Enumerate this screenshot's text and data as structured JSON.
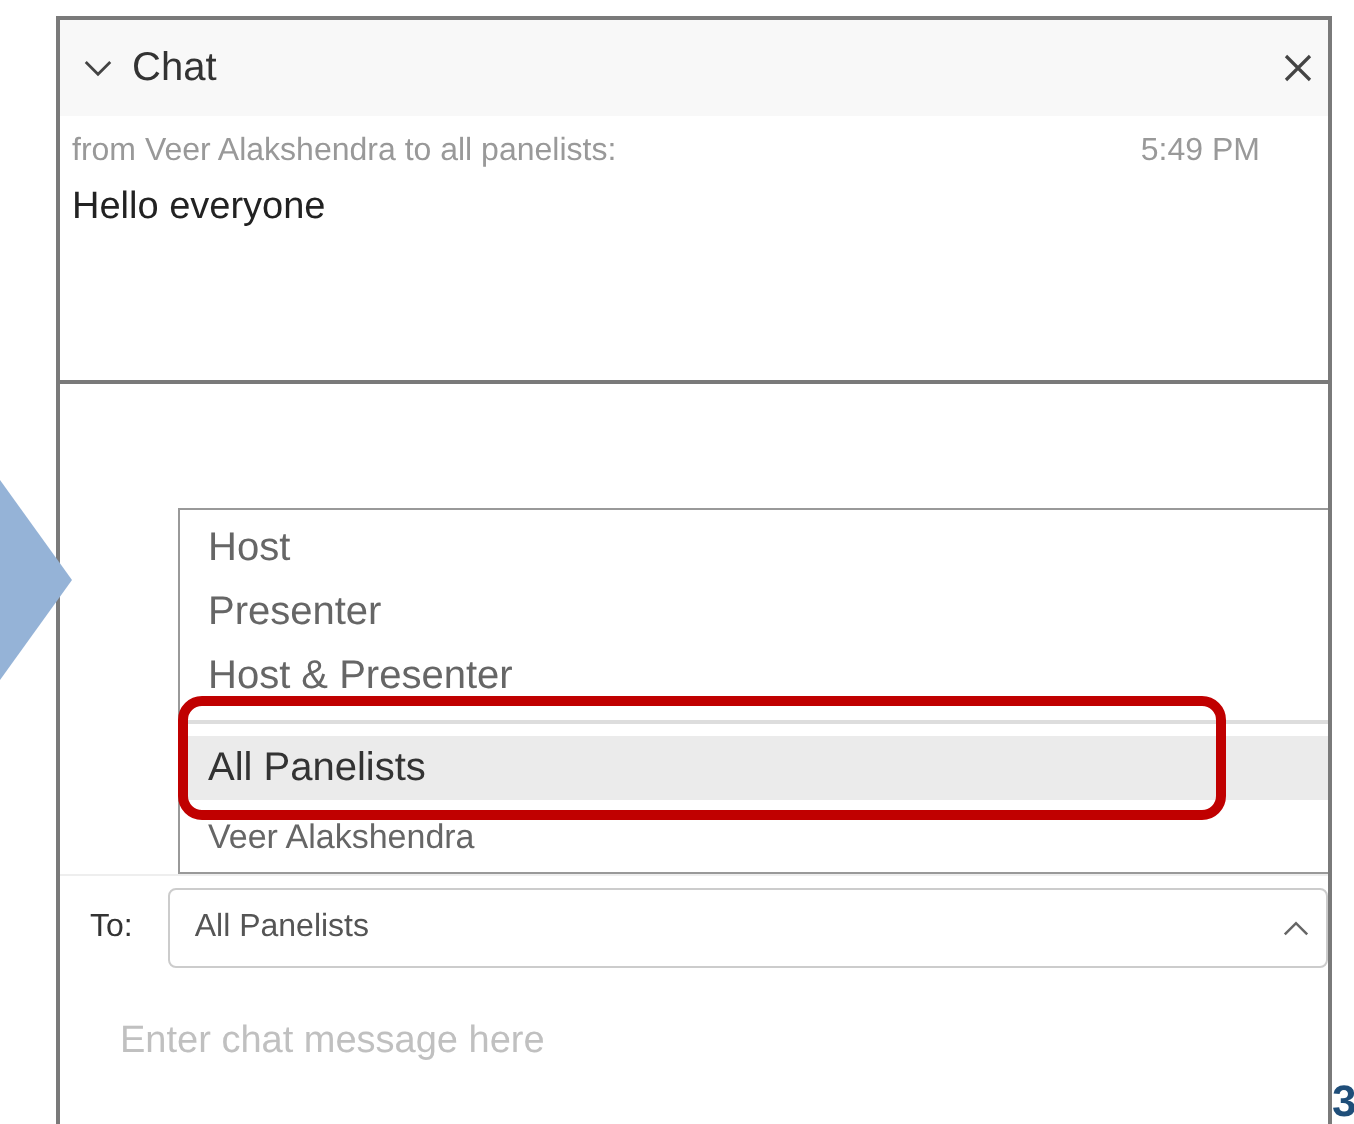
{
  "chat": {
    "title": "Chat",
    "expanded": true
  },
  "messages": [
    {
      "sender": "from Veer Alakshendra to all panelists:",
      "time": "5:49 PM",
      "text": "Hello everyone"
    }
  ],
  "recipient_menu": {
    "items": [
      {
        "kind": "option",
        "label": "Host",
        "selected": false
      },
      {
        "kind": "option",
        "label": "Presenter",
        "selected": false
      },
      {
        "kind": "option",
        "label": "Host & Presenter",
        "selected": false
      },
      {
        "kind": "divider"
      },
      {
        "kind": "option",
        "label": "All Panelists",
        "selected": true
      },
      {
        "kind": "attendee",
        "label": "Veer Alakshendra",
        "selected": false
      }
    ]
  },
  "recipient": {
    "label": "To:",
    "value": "All Panelists",
    "expanded": true
  },
  "message_field": {
    "placeholder": "Enter chat message here"
  },
  "page_number": "3"
}
